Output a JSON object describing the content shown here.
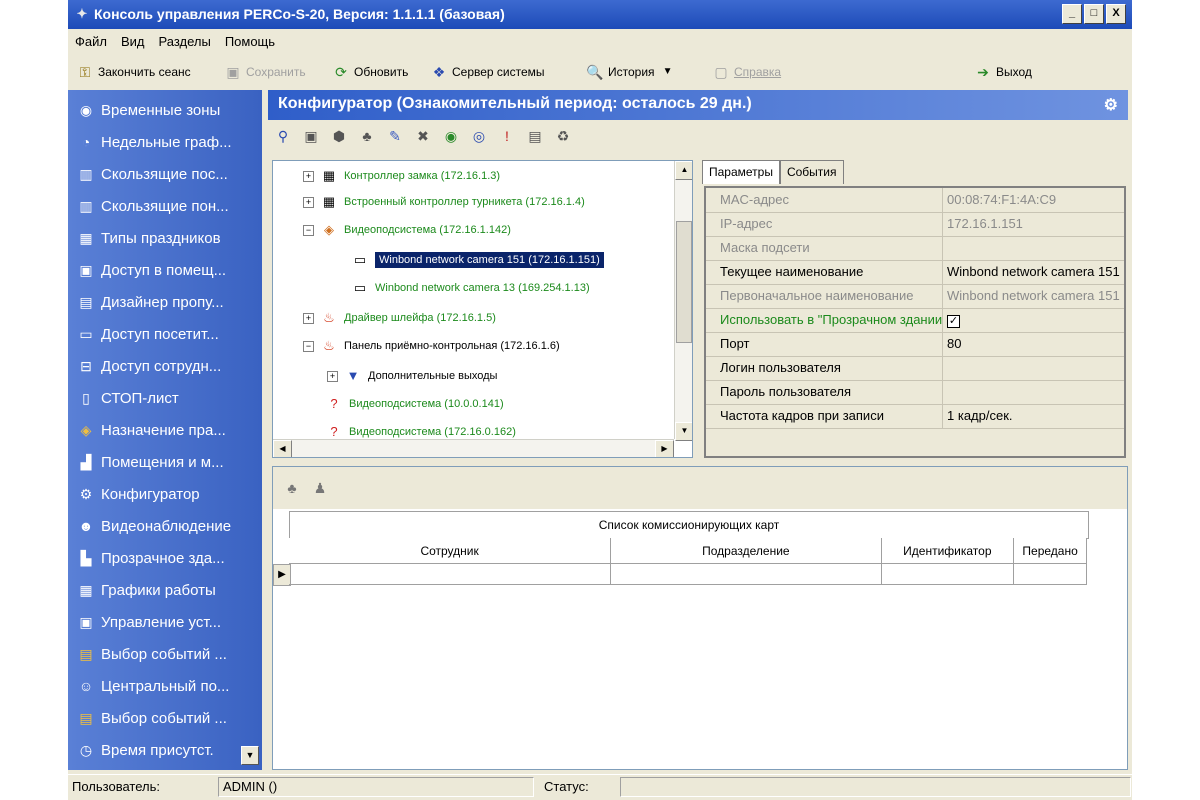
{
  "window": {
    "title": "Консоль управления PERCo-S-20, Версия: 1.1.1.1 (базовая)",
    "buttons": [
      "_",
      "□",
      "X"
    ]
  },
  "menu": [
    "Файл",
    "Вид",
    "Разделы",
    "Помощь"
  ],
  "toolbar": {
    "end_session": "Закончить сеанс",
    "save": "Сохранить",
    "refresh": "Обновить",
    "server": "Сервер системы",
    "history": "История",
    "help": "Справка",
    "exit": "Выход"
  },
  "sidebar": {
    "items": [
      "Временные зоны",
      "Недельные граф...",
      "Скользящие пос...",
      "Скользящие пон...",
      "Типы праздников",
      "Доступ в помещ...",
      "Дизайнер пропу...",
      "Доступ посетит...",
      "Доступ сотрудн...",
      "СТОП-лист",
      "Назначение пра...",
      "Помещения и м...",
      "Конфигуратор",
      "Видеонаблюдение",
      "Прозрачное зда...",
      "Графики работы",
      "Управление уст...",
      "Выбор событий ...",
      "Центральный по...",
      "Выбор событий ...",
      "Время присутст."
    ]
  },
  "header": {
    "title": "Конфигуратор (Ознакомительный период: осталось 29 дн.)"
  },
  "tree": {
    "nodes": [
      {
        "label": "Контроллер замка (172.16.1.3)"
      },
      {
        "label": "Встроенный контроллер турникета (172.16.1.4)"
      },
      {
        "label": "Видеоподсистема (172.16.1.142)"
      },
      {
        "label": "Winbond network camera 151 (172.16.1.151)"
      },
      {
        "label": "Winbond network camera 13 (169.254.1.13)"
      },
      {
        "label": "Драйвер шлейфа (172.16.1.5)"
      },
      {
        "label": "Панель приёмно-контрольная (172.16.1.6)"
      },
      {
        "label": "Дополнительные выходы"
      },
      {
        "label": "Видеоподсистема (10.0.0.141)"
      },
      {
        "label": "Видеоподсистема (172.16.0.162)"
      }
    ]
  },
  "tabs": [
    "Параметры",
    "События"
  ],
  "props": [
    {
      "key": "MAC-адрес",
      "value": "00:08:74:F1:4A:C9"
    },
    {
      "key": "IP-адрес",
      "value": "172.16.1.151"
    },
    {
      "key": "Маска подсети",
      "value": ""
    },
    {
      "key": "Текущее наименование",
      "value": "Winbond network camera 151"
    },
    {
      "key": "Первоначальное наименование",
      "value": "Winbond network camera 151"
    },
    {
      "key": "Использовать в \"Прозрачном здании\"",
      "value": "✓"
    },
    {
      "key": "Порт",
      "value": "80"
    },
    {
      "key": "Логин пользователя",
      "value": ""
    },
    {
      "key": "Пароль пользователя",
      "value": ""
    },
    {
      "key": "Частота кадров при записи",
      "value": "1 кадр/сек."
    }
  ],
  "grid": {
    "title": "Список комиссионирующих карт",
    "columns": [
      "Сотрудник",
      "Подразделение",
      "Идентификатор",
      "Передано"
    ]
  },
  "status": {
    "user_label": "Пользователь:",
    "user_value": "ADMIN ()",
    "status_label": "Статус:",
    "status_value": ""
  }
}
